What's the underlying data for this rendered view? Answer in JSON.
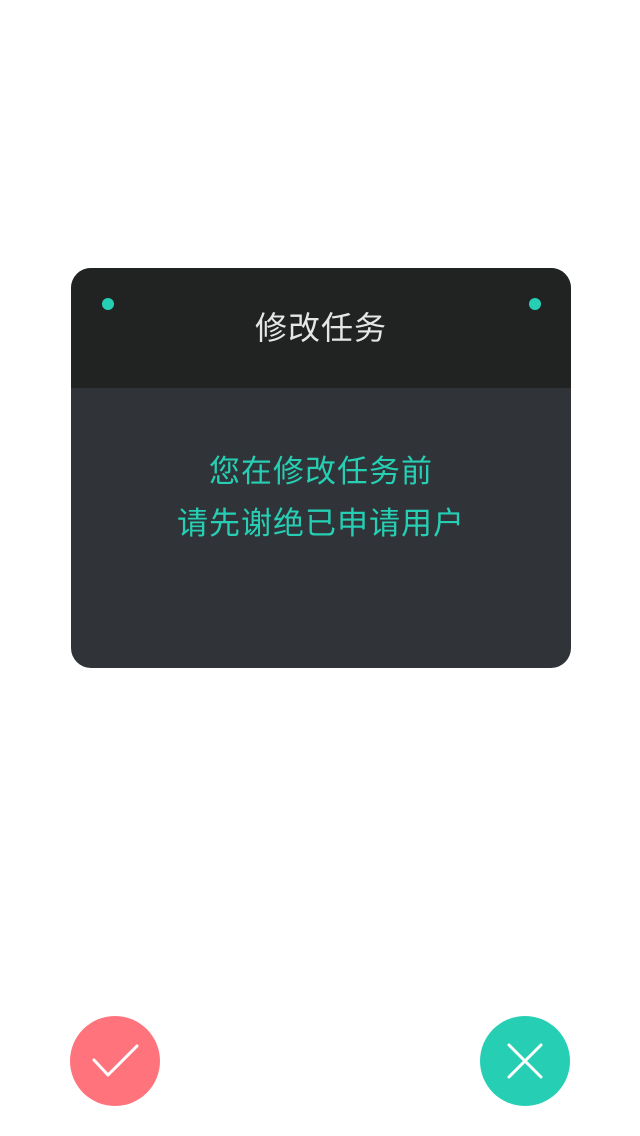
{
  "dialog": {
    "title": "修改任务",
    "message_lines": [
      "您在修改任务前",
      "请先谢绝已申请用户"
    ]
  },
  "actions": {
    "confirm_icon": "checkmark-icon",
    "cancel_icon": "close-icon"
  },
  "colors": {
    "accent": "#26cfb4",
    "confirm": "#ff747c",
    "header_bg": "#212323",
    "body_bg": "#303338"
  }
}
